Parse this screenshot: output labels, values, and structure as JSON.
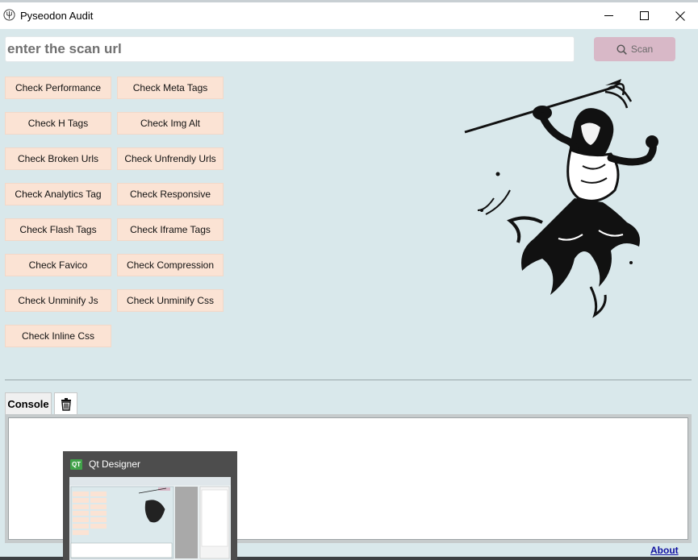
{
  "window": {
    "title": "Pyseodon Audit"
  },
  "search": {
    "placeholder": "enter the scan url",
    "value": ""
  },
  "scan_button": {
    "label": "Scan",
    "icon": "search-icon"
  },
  "checks": {
    "col1": [
      "Check Performance",
      "Check H Tags",
      "Check Broken Urls",
      "Check Analytics Tag",
      "Check Flash Tags",
      "Check Favico",
      "Check Unminify Js",
      "Check Inline Css"
    ],
    "col2": [
      "Check Meta Tags",
      "Check Img Alt",
      "Check Unfrendly Urls",
      "Check Responsive",
      "Check Iframe Tags",
      "Check Compression",
      "Check Unminify Css"
    ]
  },
  "console": {
    "tab_label": "Console",
    "clear_icon": "trash-icon",
    "content": ""
  },
  "footer": {
    "about_label": "About"
  },
  "taskbar_thumbnail": {
    "title": "Qt Designer",
    "icon_text": "QT"
  },
  "colors": {
    "background": "#d9e8eb",
    "check_button": "#fbe3d4",
    "scan_button": "#d8b8c7",
    "link": "#1010a0"
  }
}
